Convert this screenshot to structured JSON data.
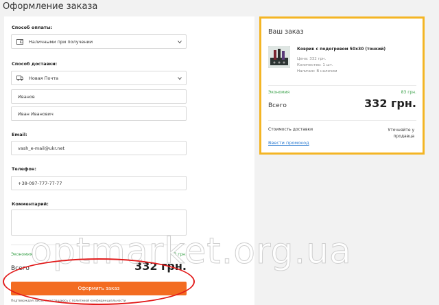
{
  "page_title": "Оформление заказа",
  "payment": {
    "label": "Способ оплаты:",
    "value": "Наличными при получении"
  },
  "delivery": {
    "label": "Способ доставки:",
    "value": "Новая Почта"
  },
  "last_name": {
    "value": "Иванов"
  },
  "full_name": {
    "value": "Иван Иванович"
  },
  "email": {
    "label": "Email:",
    "value": "vash_e-mail@ukr.net"
  },
  "phone": {
    "label": "Телефон:",
    "value": "+38-097-777-77-77"
  },
  "comment": {
    "label": "Комментарий:",
    "value": ""
  },
  "form_totals": {
    "economy_label": "Экономия",
    "economy_value": "83 грн.",
    "total_label": "Всего",
    "total_value": "332 грн."
  },
  "submit_label": "Оформить заказ",
  "privacy_text": "Подтверждая заказ, я соглашаюсь с политикой конфиденциальности",
  "summary": {
    "title": "Ваш заказ",
    "product_name": "Коврик с подогревом 50х30 (тонкий)",
    "price": "Цена: 332 грн.",
    "quantity": "Количество: 1 шт.",
    "availability": "Наличие: В наличии",
    "economy_label": "Экономия",
    "economy_value": "83 грн.",
    "total_label": "Всего",
    "total_value": "332 грн.",
    "shipping_label": "Стоимость доставки",
    "shipping_value": "Уточняйте у продавца",
    "promo_label": "Ввести промокод"
  },
  "watermark": "optmarket.org.ua",
  "colors": {
    "accent": "#f36c21",
    "summary_border": "#f4b524",
    "economy": "#3aa14a",
    "link": "#2b7bd1",
    "annotation": "#e21b1b"
  },
  "icons": {
    "payment": "wallet-icon",
    "delivery": "truck-icon",
    "select": "chevron-down-icon"
  }
}
